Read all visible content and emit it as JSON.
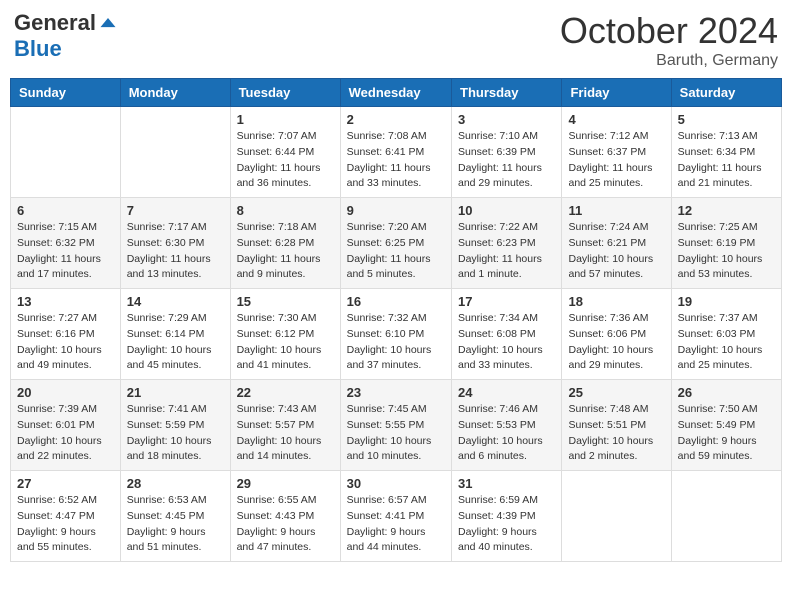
{
  "header": {
    "logo_general": "General",
    "logo_blue": "Blue",
    "month_year": "October 2024",
    "location": "Baruth, Germany"
  },
  "weekdays": [
    "Sunday",
    "Monday",
    "Tuesday",
    "Wednesday",
    "Thursday",
    "Friday",
    "Saturday"
  ],
  "weeks": [
    [
      {
        "day": "",
        "info": ""
      },
      {
        "day": "",
        "info": ""
      },
      {
        "day": "1",
        "info": "Sunrise: 7:07 AM\nSunset: 6:44 PM\nDaylight: 11 hours and 36 minutes."
      },
      {
        "day": "2",
        "info": "Sunrise: 7:08 AM\nSunset: 6:41 PM\nDaylight: 11 hours and 33 minutes."
      },
      {
        "day": "3",
        "info": "Sunrise: 7:10 AM\nSunset: 6:39 PM\nDaylight: 11 hours and 29 minutes."
      },
      {
        "day": "4",
        "info": "Sunrise: 7:12 AM\nSunset: 6:37 PM\nDaylight: 11 hours and 25 minutes."
      },
      {
        "day": "5",
        "info": "Sunrise: 7:13 AM\nSunset: 6:34 PM\nDaylight: 11 hours and 21 minutes."
      }
    ],
    [
      {
        "day": "6",
        "info": "Sunrise: 7:15 AM\nSunset: 6:32 PM\nDaylight: 11 hours and 17 minutes."
      },
      {
        "day": "7",
        "info": "Sunrise: 7:17 AM\nSunset: 6:30 PM\nDaylight: 11 hours and 13 minutes."
      },
      {
        "day": "8",
        "info": "Sunrise: 7:18 AM\nSunset: 6:28 PM\nDaylight: 11 hours and 9 minutes."
      },
      {
        "day": "9",
        "info": "Sunrise: 7:20 AM\nSunset: 6:25 PM\nDaylight: 11 hours and 5 minutes."
      },
      {
        "day": "10",
        "info": "Sunrise: 7:22 AM\nSunset: 6:23 PM\nDaylight: 11 hours and 1 minute."
      },
      {
        "day": "11",
        "info": "Sunrise: 7:24 AM\nSunset: 6:21 PM\nDaylight: 10 hours and 57 minutes."
      },
      {
        "day": "12",
        "info": "Sunrise: 7:25 AM\nSunset: 6:19 PM\nDaylight: 10 hours and 53 minutes."
      }
    ],
    [
      {
        "day": "13",
        "info": "Sunrise: 7:27 AM\nSunset: 6:16 PM\nDaylight: 10 hours and 49 minutes."
      },
      {
        "day": "14",
        "info": "Sunrise: 7:29 AM\nSunset: 6:14 PM\nDaylight: 10 hours and 45 minutes."
      },
      {
        "day": "15",
        "info": "Sunrise: 7:30 AM\nSunset: 6:12 PM\nDaylight: 10 hours and 41 minutes."
      },
      {
        "day": "16",
        "info": "Sunrise: 7:32 AM\nSunset: 6:10 PM\nDaylight: 10 hours and 37 minutes."
      },
      {
        "day": "17",
        "info": "Sunrise: 7:34 AM\nSunset: 6:08 PM\nDaylight: 10 hours and 33 minutes."
      },
      {
        "day": "18",
        "info": "Sunrise: 7:36 AM\nSunset: 6:06 PM\nDaylight: 10 hours and 29 minutes."
      },
      {
        "day": "19",
        "info": "Sunrise: 7:37 AM\nSunset: 6:03 PM\nDaylight: 10 hours and 25 minutes."
      }
    ],
    [
      {
        "day": "20",
        "info": "Sunrise: 7:39 AM\nSunset: 6:01 PM\nDaylight: 10 hours and 22 minutes."
      },
      {
        "day": "21",
        "info": "Sunrise: 7:41 AM\nSunset: 5:59 PM\nDaylight: 10 hours and 18 minutes."
      },
      {
        "day": "22",
        "info": "Sunrise: 7:43 AM\nSunset: 5:57 PM\nDaylight: 10 hours and 14 minutes."
      },
      {
        "day": "23",
        "info": "Sunrise: 7:45 AM\nSunset: 5:55 PM\nDaylight: 10 hours and 10 minutes."
      },
      {
        "day": "24",
        "info": "Sunrise: 7:46 AM\nSunset: 5:53 PM\nDaylight: 10 hours and 6 minutes."
      },
      {
        "day": "25",
        "info": "Sunrise: 7:48 AM\nSunset: 5:51 PM\nDaylight: 10 hours and 2 minutes."
      },
      {
        "day": "26",
        "info": "Sunrise: 7:50 AM\nSunset: 5:49 PM\nDaylight: 9 hours and 59 minutes."
      }
    ],
    [
      {
        "day": "27",
        "info": "Sunrise: 6:52 AM\nSunset: 4:47 PM\nDaylight: 9 hours and 55 minutes."
      },
      {
        "day": "28",
        "info": "Sunrise: 6:53 AM\nSunset: 4:45 PM\nDaylight: 9 hours and 51 minutes."
      },
      {
        "day": "29",
        "info": "Sunrise: 6:55 AM\nSunset: 4:43 PM\nDaylight: 9 hours and 47 minutes."
      },
      {
        "day": "30",
        "info": "Sunrise: 6:57 AM\nSunset: 4:41 PM\nDaylight: 9 hours and 44 minutes."
      },
      {
        "day": "31",
        "info": "Sunrise: 6:59 AM\nSunset: 4:39 PM\nDaylight: 9 hours and 40 minutes."
      },
      {
        "day": "",
        "info": ""
      },
      {
        "day": "",
        "info": ""
      }
    ]
  ]
}
